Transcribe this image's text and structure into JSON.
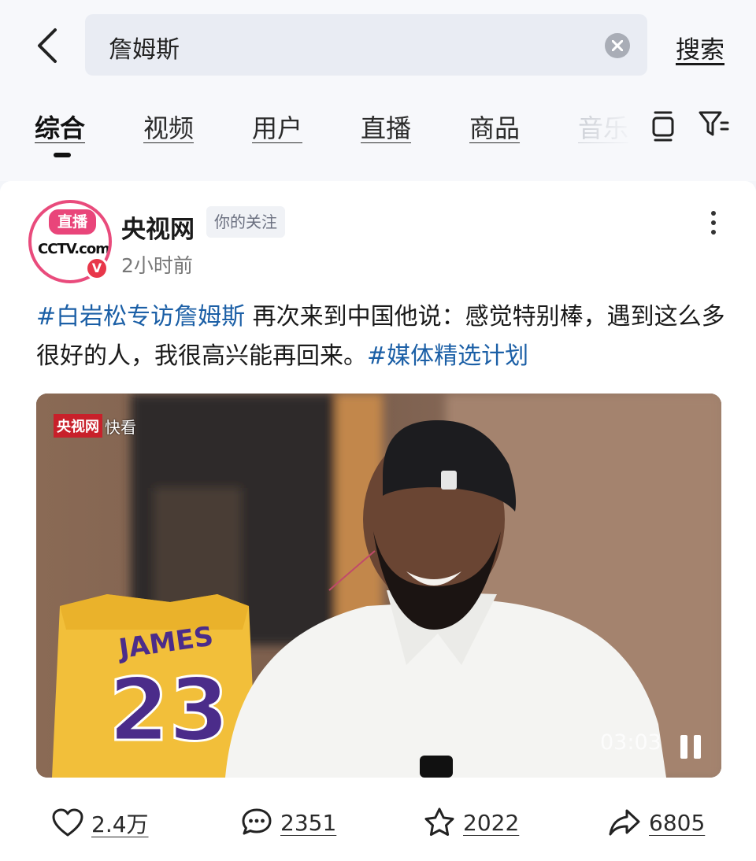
{
  "search": {
    "query": "詹姆斯",
    "submit_label": "搜索"
  },
  "tabs": [
    {
      "label": "综合",
      "active": true
    },
    {
      "label": "视频"
    },
    {
      "label": "用户"
    },
    {
      "label": "直播"
    },
    {
      "label": "商品"
    },
    {
      "label": "音乐"
    }
  ],
  "post": {
    "author": "央视网",
    "follow_badge": "你的关注",
    "time": "2小时前",
    "avatar": {
      "live_label": "直播",
      "logo_text": "CCTV.com",
      "verified_mark": "V"
    },
    "text": {
      "hashtag1": "#白岩松专访詹姆斯",
      "body": " 再次来到中国他说：感觉特别棒，遇到这么多很好的人，我很高兴能再回来。",
      "hashtag2": "#媒体精选计划"
    },
    "video": {
      "watermark_brand": "央视网",
      "watermark_text": "快看",
      "jersey_name": "JAMES",
      "jersey_number": "23",
      "duration": "03:03"
    }
  },
  "actions": {
    "likes": "2.4万",
    "comments": "2351",
    "favorites": "2022",
    "shares": "6805"
  },
  "colors": {
    "hashtag": "#1b5fa6",
    "live_pink": "#e9457a",
    "verified_red": "#e8374a"
  }
}
